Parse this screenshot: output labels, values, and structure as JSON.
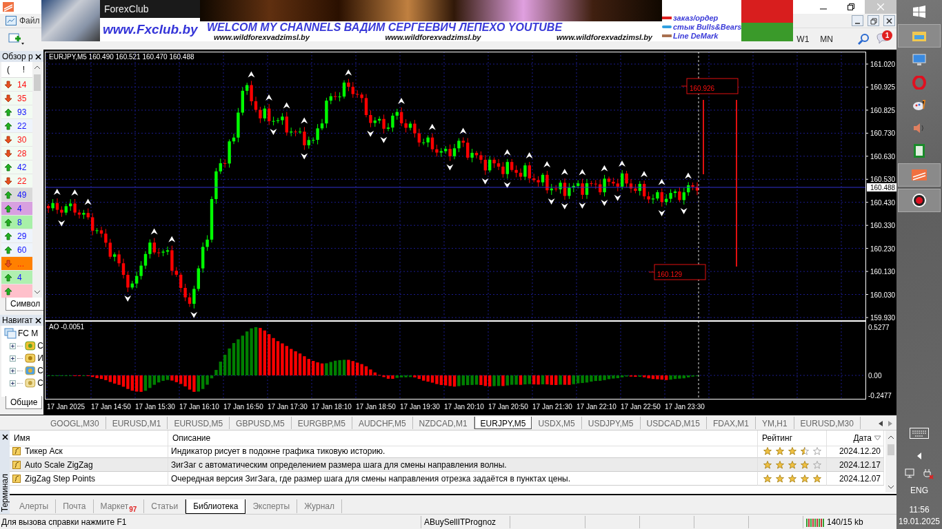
{
  "window": {
    "menu": [
      "Файл"
    ],
    "timeframes": [
      "W1",
      "MN"
    ],
    "notification_count": "1"
  },
  "banner": {
    "logo": "ForexClub",
    "site": "www.Fxclub.by",
    "headline": "WELCOM MY CHANNELS ВАДИМ СЕРГЕЕВИЧ ЛЕПЕХО YOUTUBE",
    "links": [
      "www.wildforexvadzimsl.by",
      "www.wildforexvadzimsl.by",
      "www.wildforexvadzimsl.by"
    ],
    "legend": [
      "заказ/ордер",
      "стык Bulls&Bears",
      "Line DeMark"
    ]
  },
  "market_watch": {
    "title": "Обзор р",
    "columns": [
      "(",
      "!"
    ],
    "tab": "Символ",
    "rows": [
      {
        "up": false,
        "value": "14",
        "color": "#f2fbf2"
      },
      {
        "up": false,
        "value": "35",
        "color": "#f2fbf2"
      },
      {
        "up": true,
        "value": "93",
        "color": "#f2fbf2"
      },
      {
        "up": true,
        "value": "22",
        "color": "#eef4fb"
      },
      {
        "up": false,
        "value": "30",
        "color": "#f2fbf2"
      },
      {
        "up": false,
        "value": "28",
        "color": "#f2fbf2"
      },
      {
        "up": true,
        "value": "42",
        "color": "#f2fbf2"
      },
      {
        "up": false,
        "value": "22",
        "color": "#f2fbf2"
      },
      {
        "up": true,
        "value": "49",
        "color": "#d9d9d9"
      },
      {
        "up": true,
        "value": "4",
        "color": "#d8a0e0"
      },
      {
        "up": true,
        "value": "8",
        "color": "#a8f0a8"
      },
      {
        "up": true,
        "value": "29",
        "color": "#eef4fb"
      },
      {
        "up": true,
        "value": "60",
        "color": "#eef4fb"
      },
      {
        "up": false,
        "value": "...",
        "color": "#ff8000"
      },
      {
        "up": true,
        "value": "4",
        "color": "#b0f0b0"
      },
      {
        "up": true,
        "color": "#ffc0cb"
      }
    ]
  },
  "navigator": {
    "title": "Навигат",
    "root": "FC M",
    "tab": "Общие",
    "items": [
      {
        "kind": "accounts",
        "label": "С",
        "expanded": false
      },
      {
        "kind": "indicators",
        "label": "И",
        "expanded": false
      },
      {
        "kind": "experts",
        "label": "С",
        "expanded": false
      },
      {
        "kind": "scripts",
        "label": "С",
        "expanded": false
      }
    ]
  },
  "chart": {
    "title": "EURJPY,M5  160.490 160.521 160.470 160.488",
    "price_ticks": [
      "161.020",
      "160.925",
      "160.825",
      "160.730",
      "160.630",
      "160.530",
      "160.430",
      "160.330",
      "160.230",
      "160.130",
      "160.030",
      "159.930"
    ],
    "current_price": "160.488",
    "level_labels": [
      "160.926",
      "160.129"
    ],
    "indicator": {
      "label": "AO -0.0051",
      "ticks": [
        "0.5277",
        "0.00",
        "-0.2477"
      ]
    },
    "time_labels": [
      "17 Jan 2025",
      "17 Jan 14:50",
      "17 Jan 15:30",
      "17 Jan 16:10",
      "17 Jan 16:50",
      "17 Jan 17:30",
      "17 Jan 18:10",
      "17 Jan 18:50",
      "17 Jan 19:30",
      "17 Jan 20:10",
      "17 Jan 20:50",
      "17 Jan 21:30",
      "17 Jan 22:10",
      "17 Jan 22:50",
      "17 Jan 23:30"
    ]
  },
  "chart_tabs": [
    {
      "label": "GOOGL,M30",
      "selected": false
    },
    {
      "label": "EURUSD,M1",
      "selected": false
    },
    {
      "label": "EURUSD,M5",
      "selected": false
    },
    {
      "label": "GBPUSD,M5",
      "selected": false
    },
    {
      "label": "EURGBP,M5",
      "selected": false
    },
    {
      "label": "AUDCHF,M5",
      "selected": false
    },
    {
      "label": "NZDCAD,M1",
      "selected": false
    },
    {
      "label": "EURJPY,M5",
      "selected": true
    },
    {
      "label": "USDX,M5",
      "selected": false
    },
    {
      "label": "USDJPY,M5",
      "selected": false
    },
    {
      "label": "USDCAD,M15",
      "selected": false
    },
    {
      "label": "FDAX,M1",
      "selected": false
    },
    {
      "label": "YM,H1",
      "selected": false
    },
    {
      "label": "EURUSD,M30",
      "selected": false
    }
  ],
  "terminal": {
    "title": "Терминал",
    "columns": [
      "Имя",
      "Описание",
      "Рейтинг",
      "Дата"
    ],
    "rows": [
      {
        "name": "Тикер Аск",
        "description": "Индикатор рисует в подокне графика тиковую историю.",
        "stars": 3.5,
        "date": "2024.12.20",
        "selected": false
      },
      {
        "name": "Auto Scale ZigZag",
        "description": "ЗигЗаг с автоматическим определением размера шага для смены направления волны.",
        "stars": 4,
        "date": "2024.12.17",
        "selected": true
      },
      {
        "name": "ZigZag Step Points",
        "description": "Очередная версия ЗигЗага, где размер шага для смены направления отрезка задаётся в пунктах цены.",
        "stars": 5,
        "date": "2024.12.07",
        "selected": false
      }
    ],
    "tabs": [
      {
        "label": "Алерты",
        "selected": false
      },
      {
        "label": "Почта",
        "selected": false
      },
      {
        "label": "Маркет",
        "badge": "97",
        "selected": false
      },
      {
        "label": "Статьи",
        "selected": false
      },
      {
        "label": "Библиотека",
        "selected": true
      },
      {
        "label": "Эксперты",
        "selected": false
      },
      {
        "label": "Журнал",
        "selected": false
      }
    ]
  },
  "status_bar": {
    "help": "Для вызова справки нажмите F1",
    "profile": "ABuySellITPrognoz",
    "traffic": "140/15 kb"
  },
  "taskbar": {
    "language": "ENG",
    "time": "11:56",
    "date": "19.01.2025"
  }
}
